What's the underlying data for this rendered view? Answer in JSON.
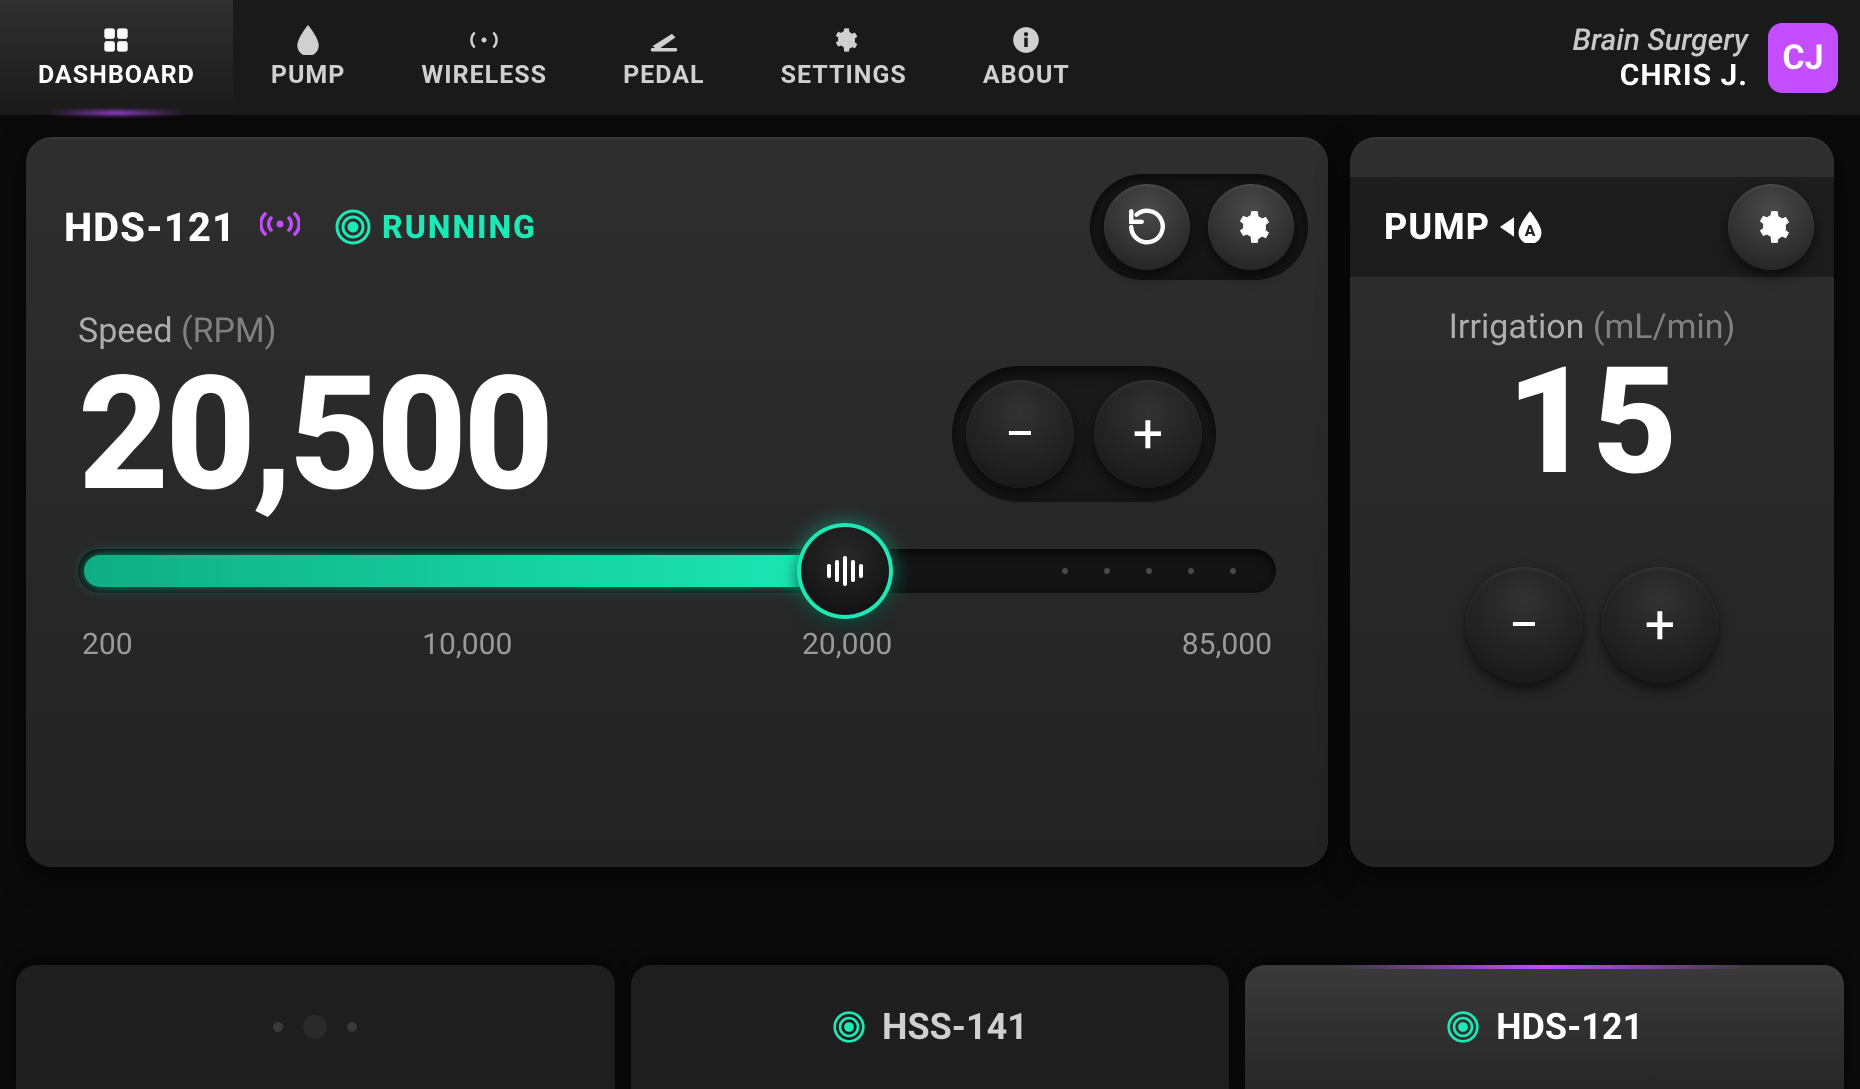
{
  "nav": {
    "tabs": [
      {
        "label": "DASHBOARD",
        "active": true
      },
      {
        "label": "PUMP"
      },
      {
        "label": "WIRELESS"
      },
      {
        "label": "PEDAL"
      },
      {
        "label": "SETTINGS"
      },
      {
        "label": "ABOUT"
      }
    ],
    "procedure_title": "Brain Surgery",
    "user_name": "CHRIS J.",
    "user_initials": "CJ"
  },
  "motor": {
    "device_name": "HDS-121",
    "status_text": "RUNNING",
    "speed_label": "Speed",
    "speed_unit": "(RPM)",
    "speed_value": "20,500",
    "slider": {
      "fill_percent": 64,
      "ticks": [
        "200",
        "10,000",
        "20,000",
        "85,000"
      ]
    }
  },
  "pump": {
    "title": "PUMP",
    "port": "A",
    "label": "Irrigation",
    "unit": "(mL/min)",
    "value": "15"
  },
  "bottom_tabs": [
    {
      "label": "",
      "icon": "dots"
    },
    {
      "label": "HSS-141",
      "icon": "target"
    },
    {
      "label": "HDS-121",
      "icon": "target",
      "active": true
    }
  ],
  "colors": {
    "accent_green": "#1de9b6",
    "accent_purple": "#c44dff"
  }
}
